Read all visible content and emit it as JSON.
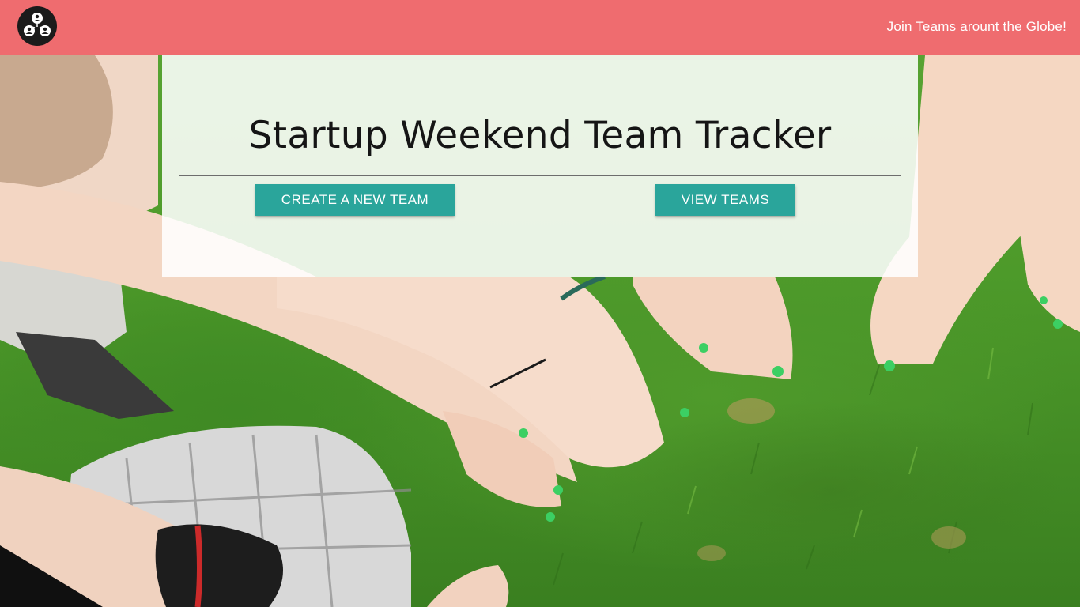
{
  "navbar": {
    "logo_icon": "team-network-logo-icon",
    "link_label": "Join Teams arount the Globe!",
    "background_color": "#ef6c6f"
  },
  "hero": {
    "title": "Startup Weekend Team Tracker",
    "create_button_label": "CREATE A NEW TEAM",
    "view_button_label": "VIEW TEAMS",
    "button_color": "#2aa59b"
  },
  "background": {
    "description_icon": "grass-people-photo"
  }
}
